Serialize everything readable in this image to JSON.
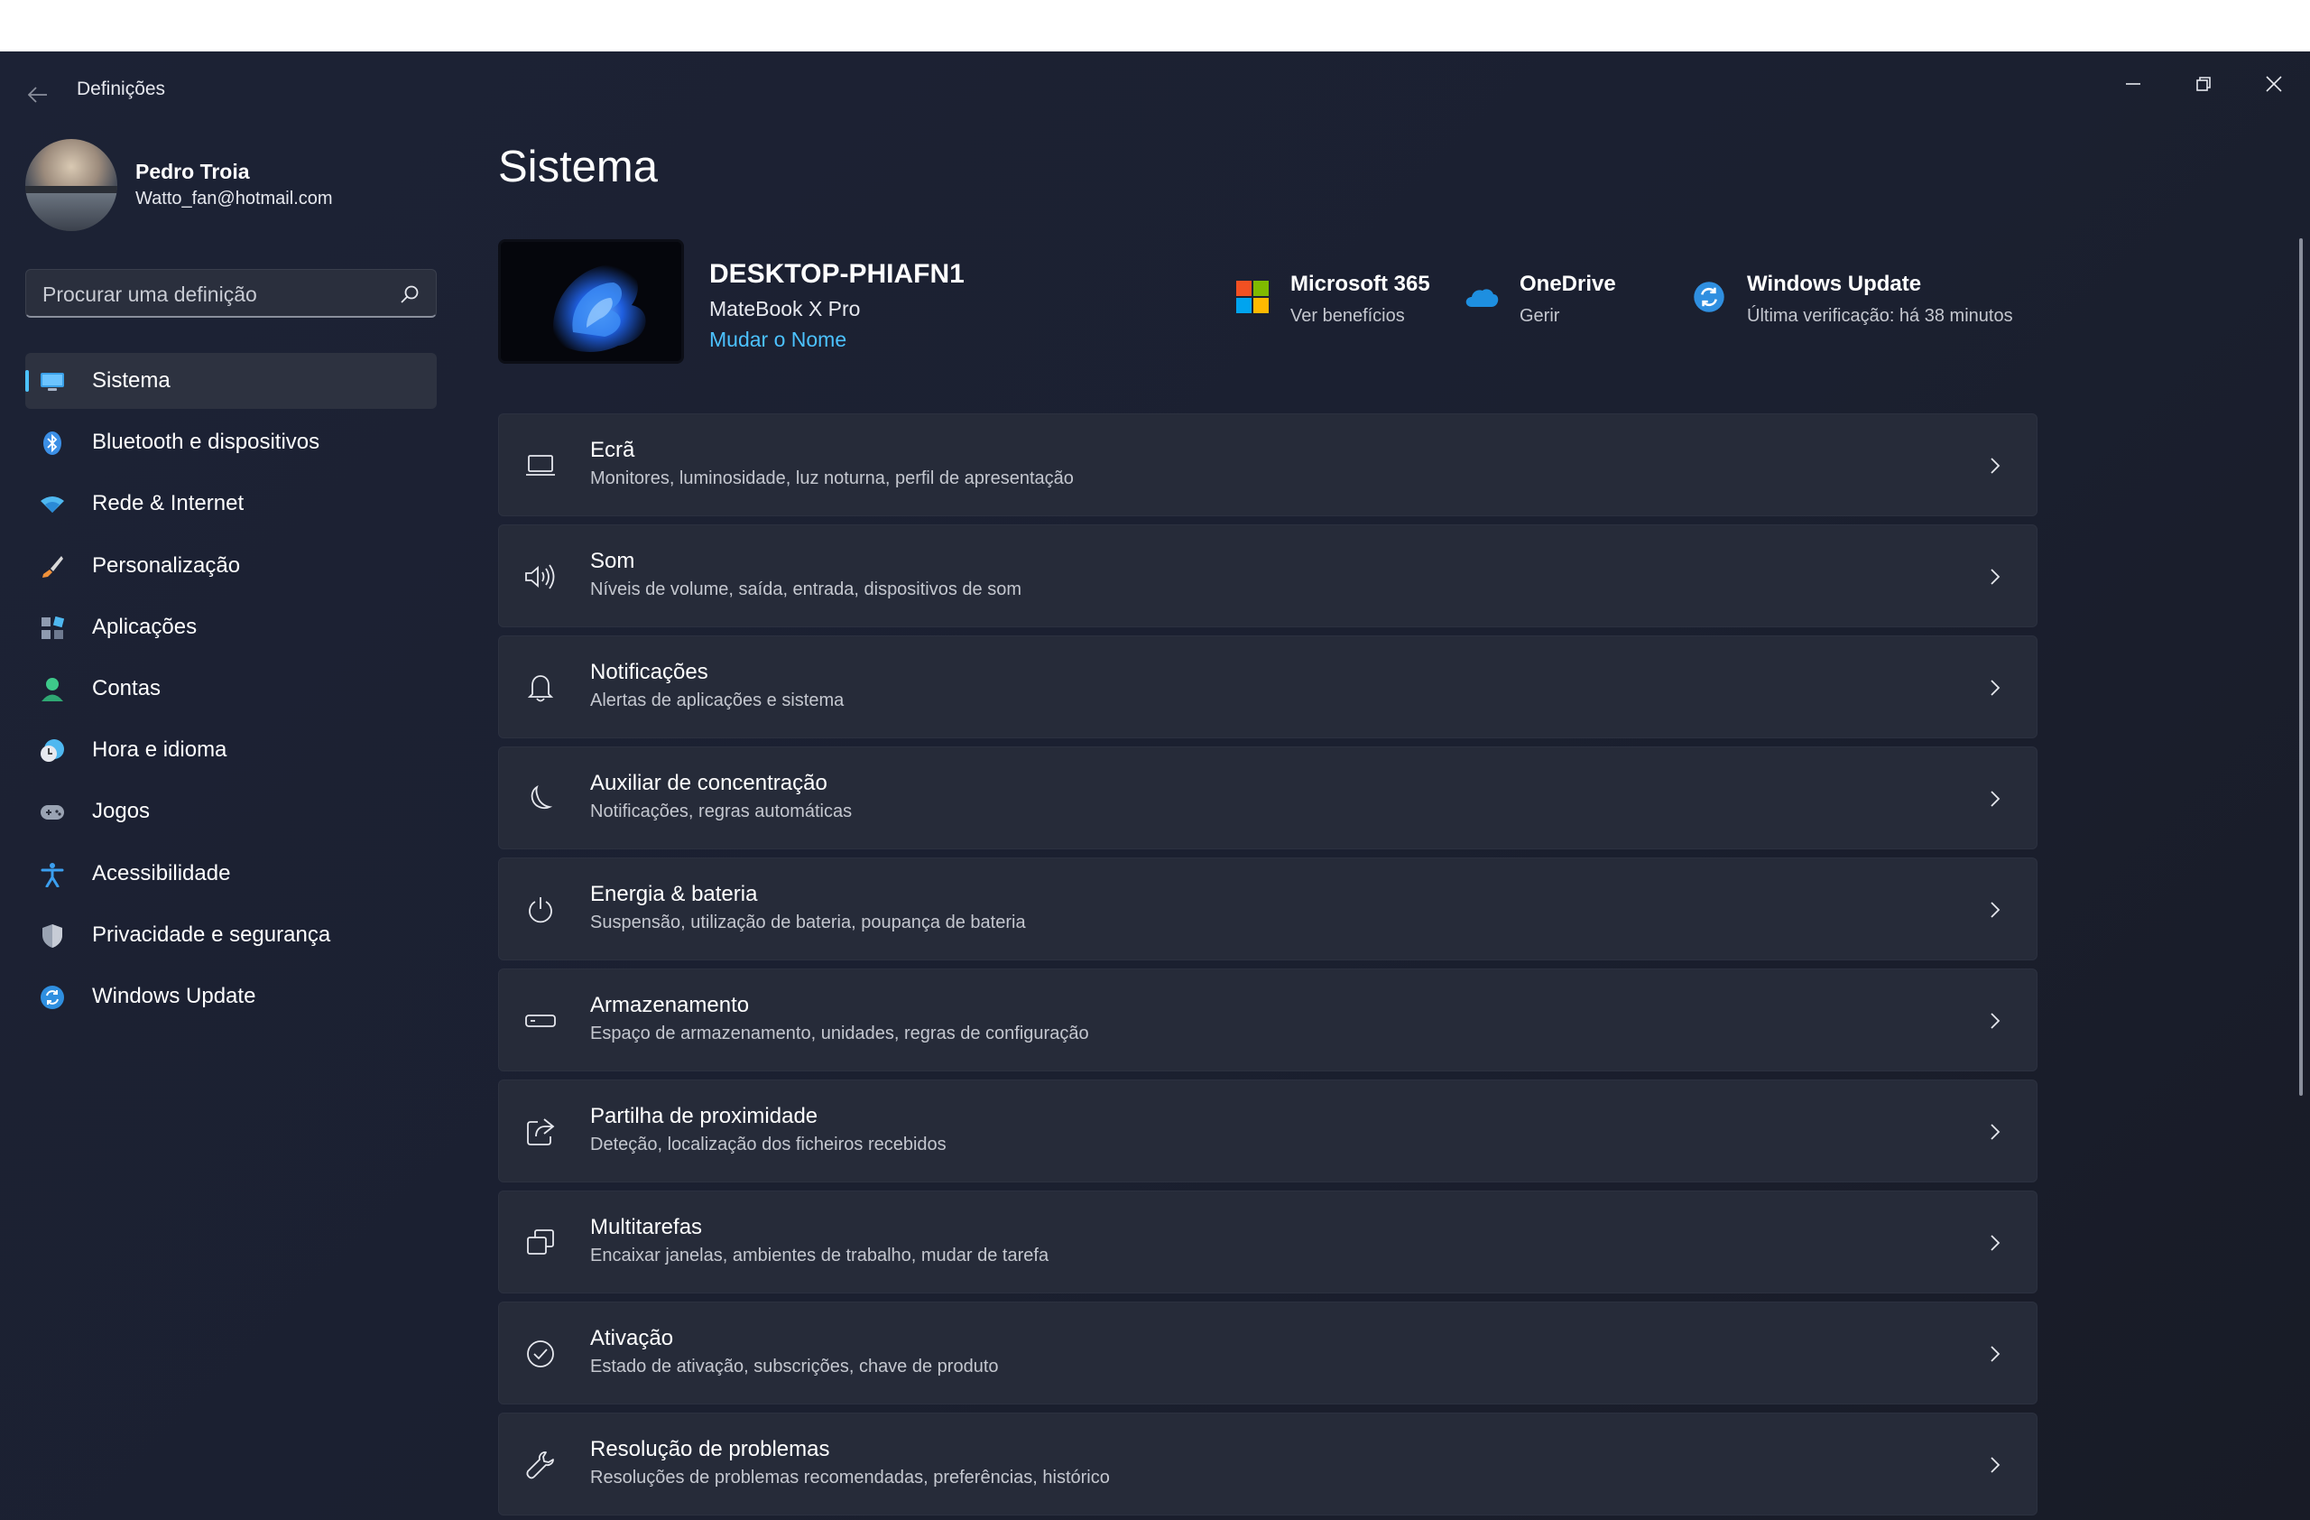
{
  "window": {
    "title": "Definições",
    "controls": {
      "minimize": "minimize-icon",
      "maximize": "restore-icon",
      "close": "close-icon"
    }
  },
  "profile": {
    "name": "Pedro Troia",
    "email": "Watto_fan@hotmail.com"
  },
  "search": {
    "placeholder": "Procurar uma definição",
    "value": ""
  },
  "sidebar": {
    "items": [
      {
        "label": "Sistema",
        "icon": "monitor-icon",
        "selected": true
      },
      {
        "label": "Bluetooth e dispositivos",
        "icon": "bluetooth-icon"
      },
      {
        "label": "Rede & Internet",
        "icon": "wifi-icon"
      },
      {
        "label": "Personalização",
        "icon": "paintbrush-icon"
      },
      {
        "label": "Aplicações",
        "icon": "apps-icon"
      },
      {
        "label": "Contas",
        "icon": "person-icon"
      },
      {
        "label": "Hora e idioma",
        "icon": "clock-globe-icon"
      },
      {
        "label": "Jogos",
        "icon": "gamepad-icon"
      },
      {
        "label": "Acessibilidade",
        "icon": "accessibility-icon"
      },
      {
        "label": "Privacidade e segurança",
        "icon": "shield-icon"
      },
      {
        "label": "Windows Update",
        "icon": "windows-update-icon"
      }
    ]
  },
  "main": {
    "title": "Sistema",
    "device": {
      "name": "DESKTOP-PHIAFN1",
      "model": "MateBook X Pro",
      "rename_label": "Mudar o Nome"
    },
    "quick_links": [
      {
        "title": "Microsoft 365",
        "subtitle": "Ver benefícios",
        "icon": "microsoft-logo-icon"
      },
      {
        "title": "OneDrive",
        "subtitle": "Gerir",
        "icon": "onedrive-cloud-icon"
      },
      {
        "title": "Windows Update",
        "subtitle": "Última verificação: há 38 minutos",
        "icon": "windows-update-icon"
      }
    ],
    "cards": [
      {
        "title": "Ecrã",
        "subtitle": "Monitores, luminosidade, luz noturna, perfil de apresentação",
        "icon": "laptop-icon"
      },
      {
        "title": "Som",
        "subtitle": "Níveis de volume, saída, entrada, dispositivos de som",
        "icon": "speaker-icon"
      },
      {
        "title": "Notificações",
        "subtitle": "Alertas de aplicações e sistema",
        "icon": "bell-icon"
      },
      {
        "title": "Auxiliar de concentração",
        "subtitle": "Notificações, regras automáticas",
        "icon": "moon-icon"
      },
      {
        "title": "Energia & bateria",
        "subtitle": "Suspensão, utilização de bateria, poupança de bateria",
        "icon": "power-icon"
      },
      {
        "title": "Armazenamento",
        "subtitle": "Espaço de armazenamento, unidades, regras de configuração",
        "icon": "storage-drive-icon"
      },
      {
        "title": "Partilha de proximidade",
        "subtitle": "Deteção, localização dos ficheiros recebidos",
        "icon": "share-icon"
      },
      {
        "title": "Multitarefas",
        "subtitle": "Encaixar janelas, ambientes de trabalho, mudar de tarefa",
        "icon": "multitask-icon"
      },
      {
        "title": "Ativação",
        "subtitle": "Estado de ativação, subscrições, chave de produto",
        "icon": "check-circle-icon"
      },
      {
        "title": "Resolução de problemas",
        "subtitle": "Resoluções de problemas recomendadas, preferências, histórico",
        "icon": "wrench-icon"
      }
    ]
  }
}
